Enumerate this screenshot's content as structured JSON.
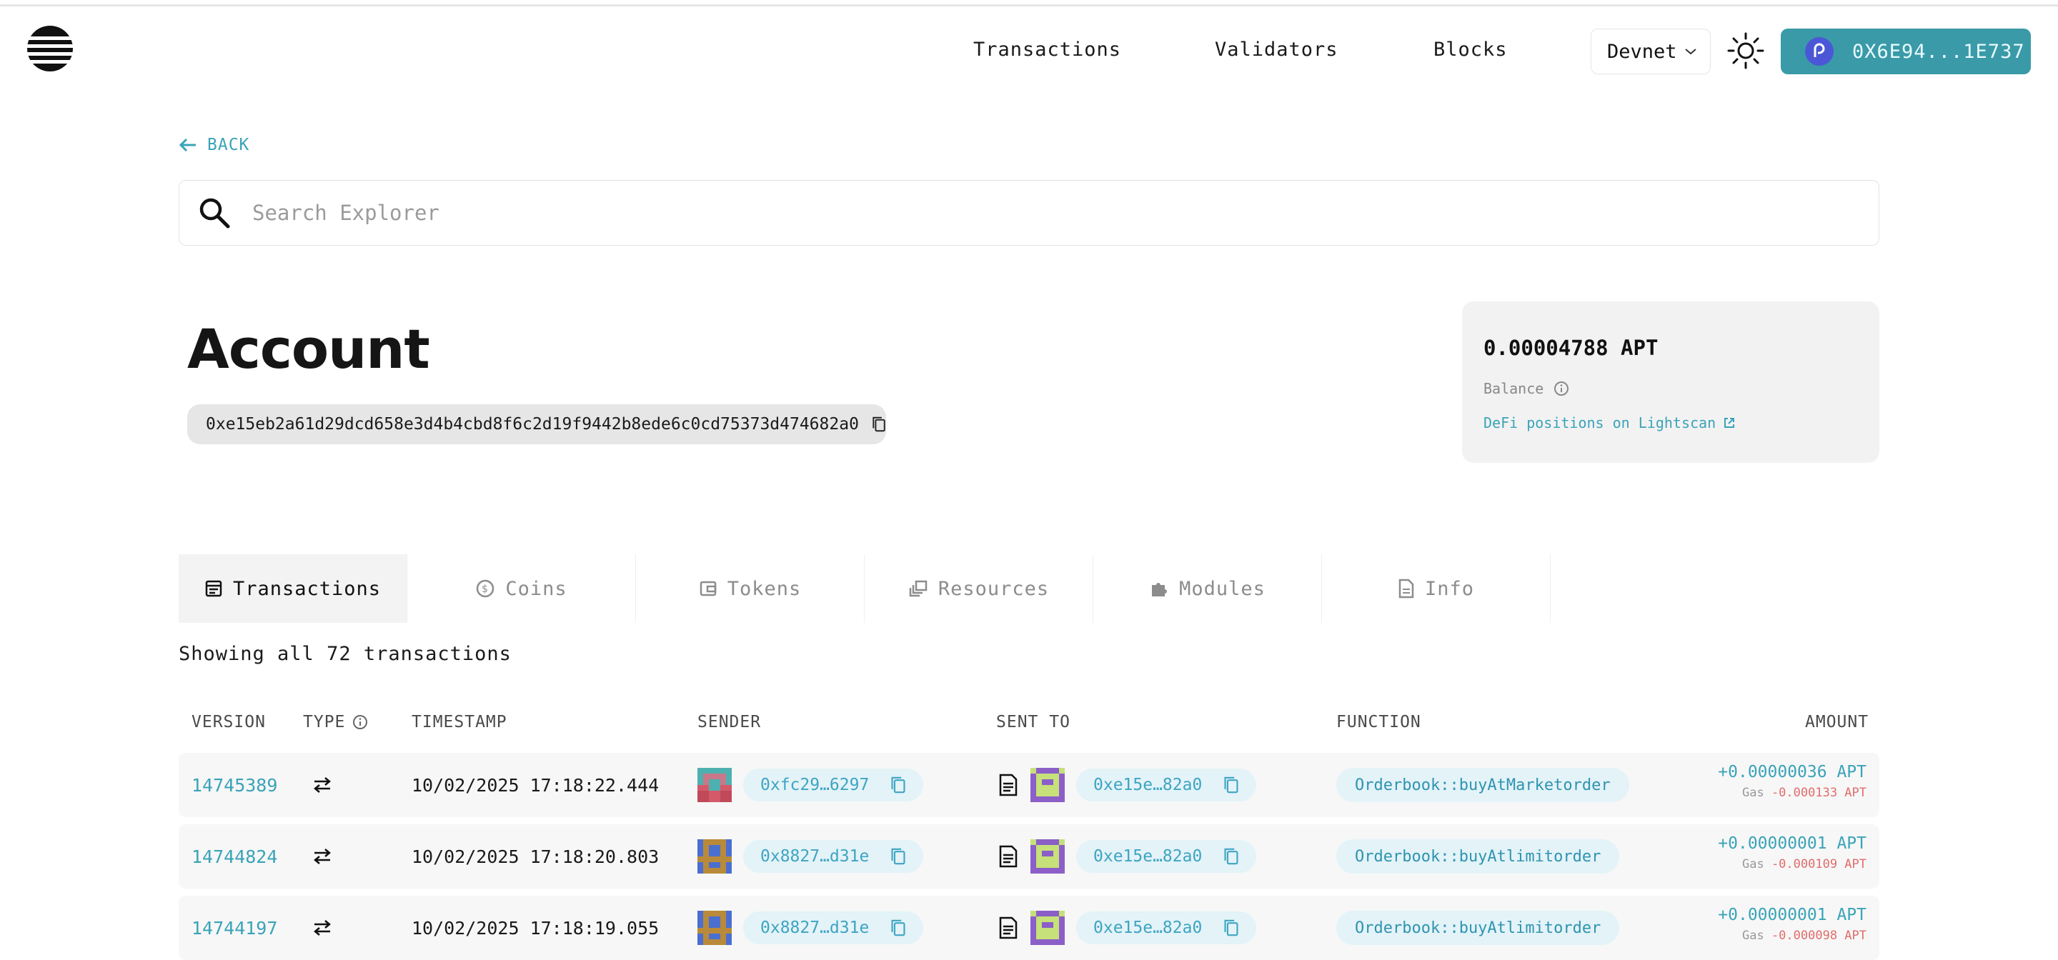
{
  "header": {
    "nav": [
      "Transactions",
      "Validators",
      "Blocks"
    ],
    "network": "Devnet",
    "wallet": "0X6E94...1E737"
  },
  "back_label": "BACK",
  "search": {
    "placeholder": "Search Explorer"
  },
  "account": {
    "title": "Account",
    "address": "0xe15eb2a61d29dcd658e3d4b4cbd8f6c2d19f9442b8ede6c0cd75373d474682a0"
  },
  "balance": {
    "amount": "0.00004788 APT",
    "label": "Balance",
    "defi_link": "DeFi positions on Lightscan"
  },
  "tabs": [
    {
      "label": "Transactions",
      "icon": "transactions-icon",
      "active": true
    },
    {
      "label": "Coins",
      "icon": "coin-icon",
      "active": false
    },
    {
      "label": "Tokens",
      "icon": "wallet-icon",
      "active": false
    },
    {
      "label": "Resources",
      "icon": "stack-icon",
      "active": false
    },
    {
      "label": "Modules",
      "icon": "puzzle-icon",
      "active": false
    },
    {
      "label": "Info",
      "icon": "document-icon",
      "active": false
    }
  ],
  "showing_text": "Showing all 72 transactions",
  "table": {
    "headers": {
      "version": "VERSION",
      "type": "TYPE",
      "timestamp": "TIMESTAMP",
      "sender": "SENDER",
      "sent_to": "SENT TO",
      "function": "FUNCTION",
      "amount": "AMOUNT"
    },
    "rows": [
      {
        "version": "14745389",
        "timestamp": "10/02/2025 17:18:22.444",
        "sender": "0xfc29…6297",
        "sent_to": "0xe15e…82a0",
        "function": "Orderbook::buyAtMarketorder",
        "amount": "+0.00000036 APT",
        "gas_label": "Gas",
        "gas": "-0.000133 APT"
      },
      {
        "version": "14744824",
        "timestamp": "10/02/2025 17:18:20.803",
        "sender": "0x8827…d31e",
        "sent_to": "0xe15e…82a0",
        "function": "Orderbook::buyAtlimitorder",
        "amount": "+0.00000001 APT",
        "gas_label": "Gas",
        "gas": "-0.000109 APT"
      },
      {
        "version": "14744197",
        "timestamp": "10/02/2025 17:18:19.055",
        "sender": "0x8827…d31e",
        "sent_to": "0xe15e…82a0",
        "function": "Orderbook::buyAtlimitorder",
        "amount": "+0.00000001 APT",
        "gas_label": "Gas",
        "gas": "-0.000098 APT"
      }
    ]
  },
  "colors": {
    "accent": "#3aa3b8",
    "wallet_button": "#3a9aa8",
    "negative": "#e06c6c"
  }
}
